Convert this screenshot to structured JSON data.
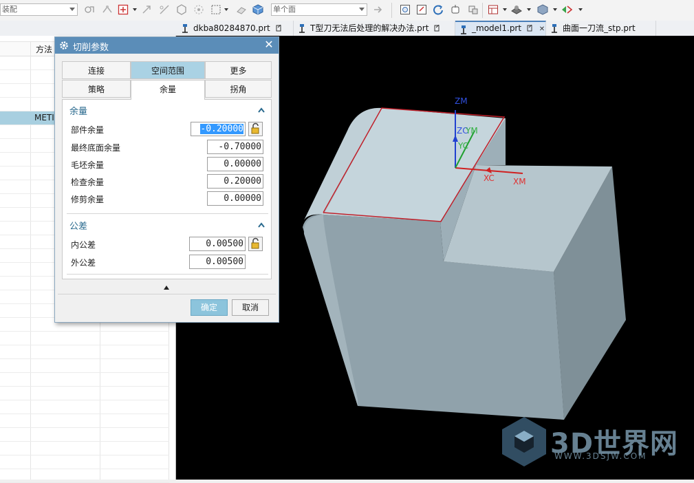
{
  "toolbar": {
    "assembly_combo": "装配",
    "selection_combo": "单个面"
  },
  "file_tabs": [
    {
      "label": "dkba80284870.prt",
      "active": false
    },
    {
      "label": "T型刀无法后处理的解决办法.prt",
      "active": false
    },
    {
      "label": "_model1.prt",
      "active": true
    },
    {
      "label": "曲面一刀流_stp.prt",
      "active": false
    }
  ],
  "left_panel": {
    "column_method": "方法",
    "selected_row_value": "METI"
  },
  "dialog": {
    "title": "切削参数",
    "tabs_row1": [
      "连接",
      "空间范围",
      "更多"
    ],
    "tabs_row2": [
      "策略",
      "余量",
      "拐角"
    ],
    "section_allowance": {
      "title": "余量",
      "fields": [
        {
          "label": "部件余量",
          "value": "-0.20000"
        },
        {
          "label": "最终底面余量",
          "value": "-0.70000"
        },
        {
          "label": "毛坯余量",
          "value": "0.00000"
        },
        {
          "label": "检查余量",
          "value": "0.20000"
        },
        {
          "label": "修剪余量",
          "value": "0.00000"
        }
      ]
    },
    "section_tolerance": {
      "title": "公差",
      "fields": [
        {
          "label": "内公差",
          "value": "0.00500"
        },
        {
          "label": "外公差",
          "value": "0.00500"
        }
      ]
    },
    "ok_label": "确定",
    "cancel_label": "取消"
  },
  "viewport": {
    "axis_labels": {
      "zm": "ZM",
      "zc": "ZC",
      "ym": "YM",
      "yc": "YC",
      "xc": "XC",
      "xm": "XM"
    }
  },
  "watermark": {
    "brand": "3D世界网",
    "url": "WWW.3DSJW.COM"
  }
}
